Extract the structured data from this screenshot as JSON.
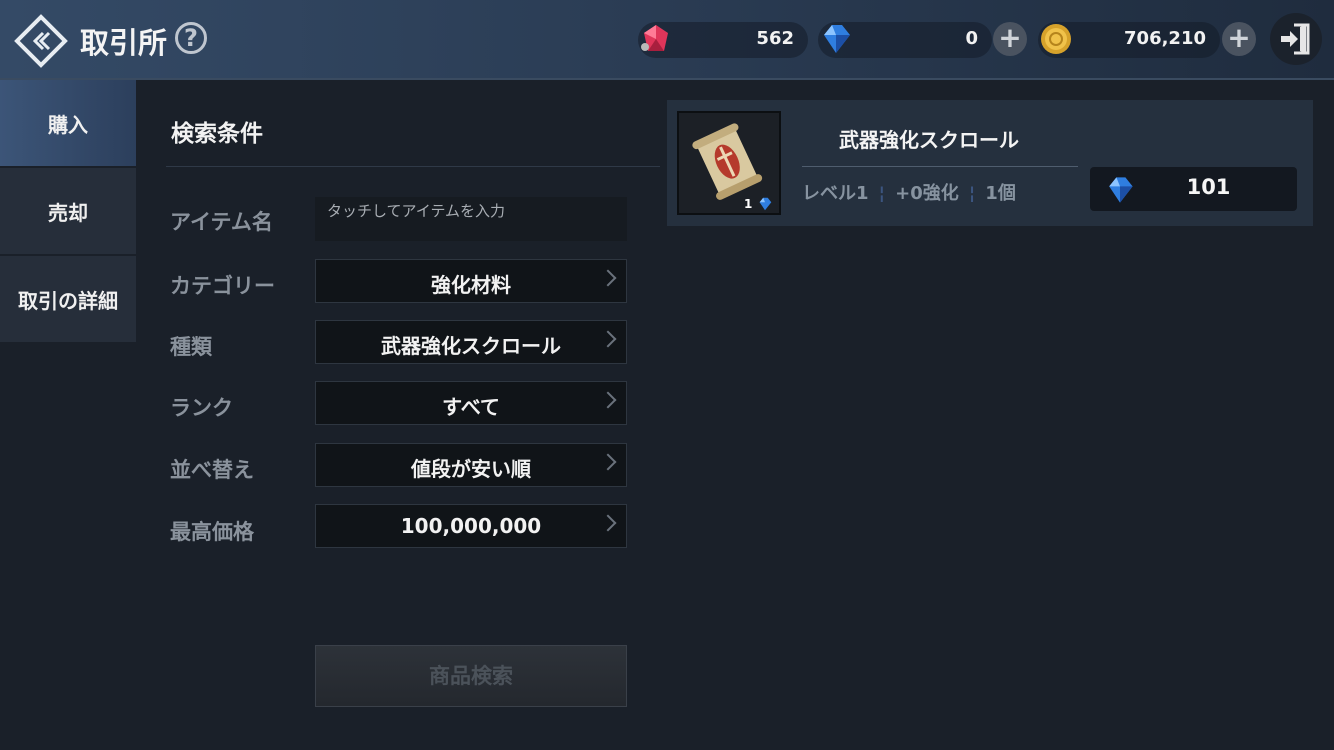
{
  "header": {
    "title": "取引所",
    "help_label": "?"
  },
  "currencies": {
    "ruby": {
      "value": "562",
      "icon": "red-gem-icon",
      "color": "#e0355a"
    },
    "diamond": {
      "value": "0",
      "icon": "blue-diamond-icon",
      "color": "#2f7ee0"
    },
    "gold": {
      "value": "706,210",
      "icon": "gold-coin-icon",
      "color": "#d6a22b"
    },
    "plus_label": "+"
  },
  "tabs": [
    {
      "label": "購入",
      "active": true
    },
    {
      "label": "売却",
      "active": false
    },
    {
      "label": "取引の詳細",
      "active": false
    }
  ],
  "search": {
    "title": "検索条件",
    "item_name": {
      "label": "アイテム名",
      "placeholder": "タッチしてアイテムを入力"
    },
    "category": {
      "label": "カテゴリー",
      "value": "強化材料"
    },
    "type": {
      "label": "種類",
      "value": "武器強化スクロール"
    },
    "rank": {
      "label": "ランク",
      "value": "すべて"
    },
    "sort": {
      "label": "並べ替え",
      "value": "値段が安い順"
    },
    "max_price": {
      "label": "最高価格",
      "value": "100,000,000"
    },
    "button_label": "商品検索"
  },
  "results": [
    {
      "name": "武器強化スクロール",
      "level": "レベル1",
      "enhance": "+0強化",
      "count": "1個",
      "thumb_count": "1",
      "price": "101",
      "icon": "scroll-icon"
    }
  ]
}
